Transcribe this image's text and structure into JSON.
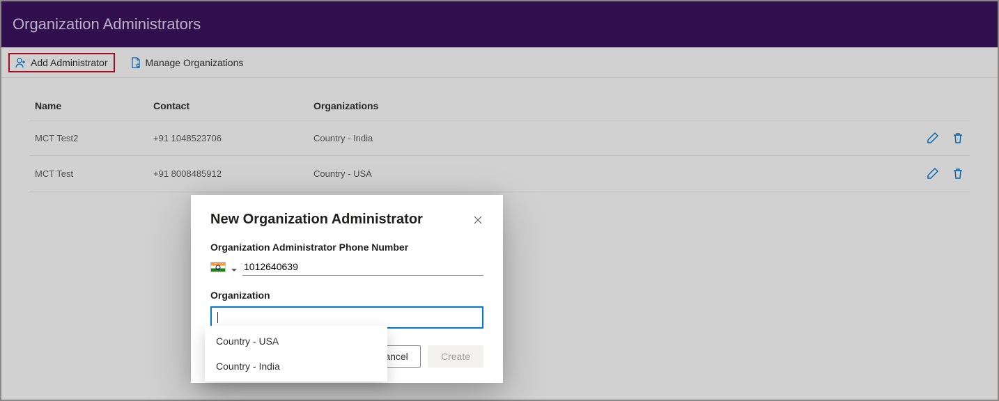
{
  "header": {
    "title": "Organization Administrators"
  },
  "toolbar": {
    "add_label": "Add Administrator",
    "manage_label": "Manage Organizations"
  },
  "table": {
    "headers": {
      "name": "Name",
      "contact": "Contact",
      "orgs": "Organizations"
    },
    "rows": [
      {
        "name": "MCT Test2",
        "contact": "+91 1048523706",
        "orgs": "Country - India"
      },
      {
        "name": "MCT Test",
        "contact": "+91 8008485912",
        "orgs": "Country - USA"
      }
    ]
  },
  "dialog": {
    "title": "New Organization Administrator",
    "phone_label": "Organization Administrator Phone Number",
    "phone_value": "1012640639",
    "phone_country": "India",
    "org_label": "Organization",
    "org_value": "",
    "cancel_label": "Cancel",
    "create_label": "Create",
    "suggestions": [
      "Country - USA",
      "Country - India"
    ]
  },
  "icons": {
    "add_admin": "person-add-icon",
    "manage_org": "org-doc-icon",
    "edit": "pencil-icon",
    "delete": "trash-icon",
    "close": "close-icon",
    "chevron": "chevron-down-icon"
  },
  "colors": {
    "accent_purple": "#3c1361",
    "link_blue": "#0078d4",
    "highlight_red": "#c8102e"
  }
}
